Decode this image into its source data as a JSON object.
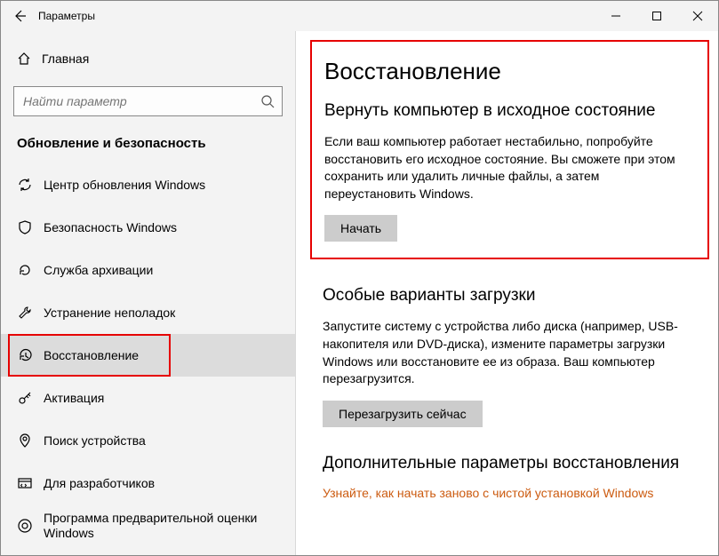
{
  "titlebar": {
    "title": "Параметры"
  },
  "sidebar": {
    "home": "Главная",
    "search_placeholder": "Найти параметр",
    "section": "Обновление и безопасность",
    "items": [
      {
        "label": "Центр обновления Windows"
      },
      {
        "label": "Безопасность Windows"
      },
      {
        "label": "Служба архивации"
      },
      {
        "label": "Устранение неполадок"
      },
      {
        "label": "Восстановление"
      },
      {
        "label": "Активация"
      },
      {
        "label": "Поиск устройства"
      },
      {
        "label": "Для разработчиков"
      },
      {
        "label": "Программа предварительной оценки Windows"
      }
    ]
  },
  "main": {
    "heading": "Восстановление",
    "reset": {
      "title": "Вернуть компьютер в исходное состояние",
      "desc": "Если ваш компьютер работает нестабильно, попробуйте восстановить его исходное состояние. Вы сможете при этом сохранить или удалить личные файлы, а затем переустановить Windows.",
      "button": "Начать"
    },
    "advanced": {
      "title": "Особые варианты загрузки",
      "desc": "Запустите систему с устройства либо диска (например, USB-накопителя или DVD-диска), измените параметры загрузки Windows или восстановите ее из образа. Ваш компьютер перезагрузится.",
      "button": "Перезагрузить сейчас"
    },
    "more": {
      "title": "Дополнительные параметры восстановления",
      "link": "Узнайте, как начать заново с чистой установкой Windows"
    }
  }
}
